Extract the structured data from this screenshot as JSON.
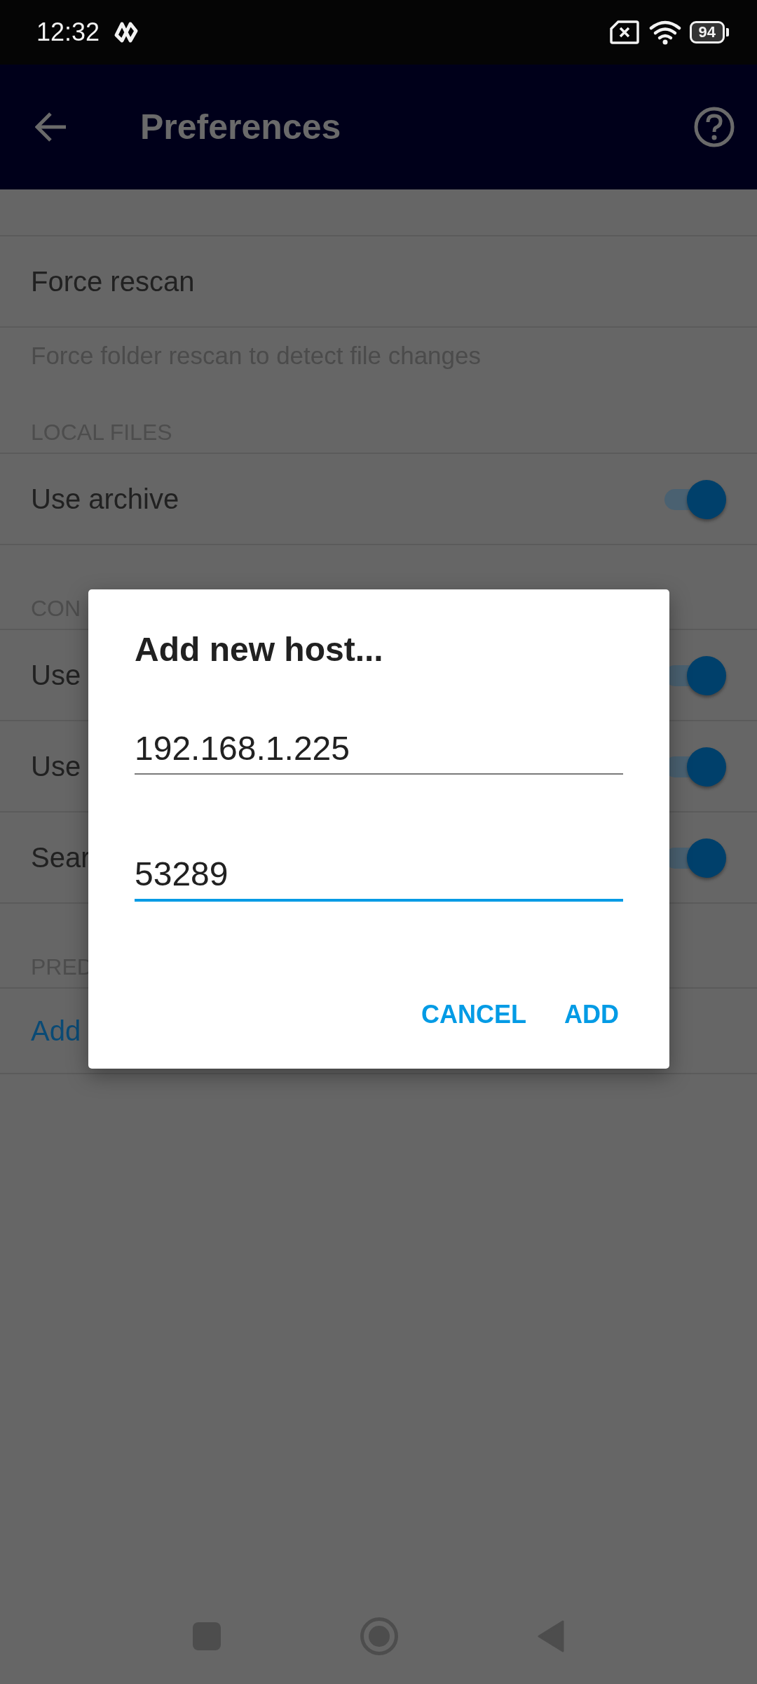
{
  "status_bar": {
    "time": "12:32",
    "battery": "94"
  },
  "app_bar": {
    "title": "Preferences"
  },
  "preferences": [
    {
      "kind": "spacer"
    },
    {
      "kind": "action",
      "title": "Force rescan"
    },
    {
      "kind": "summary",
      "text": "Force folder rescan to detect file changes"
    },
    {
      "kind": "category",
      "title": "LOCAL FILES"
    },
    {
      "kind": "toggle",
      "title": "Use archive",
      "on": true
    },
    {
      "kind": "category",
      "title": "CON"
    },
    {
      "kind": "toggle",
      "title": "Use",
      "on": true
    },
    {
      "kind": "toggle",
      "title": "Use",
      "on": true
    },
    {
      "kind": "toggle",
      "title": "Sear",
      "on": true
    },
    {
      "kind": "category",
      "title": "PRED"
    },
    {
      "kind": "link",
      "title": "Add"
    }
  ],
  "dialog": {
    "title": "Add new host...",
    "fields": [
      {
        "value": "192.168.1.225",
        "focused": false
      },
      {
        "value": "53289",
        "focused": true
      }
    ],
    "buttons": [
      "CANCEL",
      "ADD"
    ]
  }
}
